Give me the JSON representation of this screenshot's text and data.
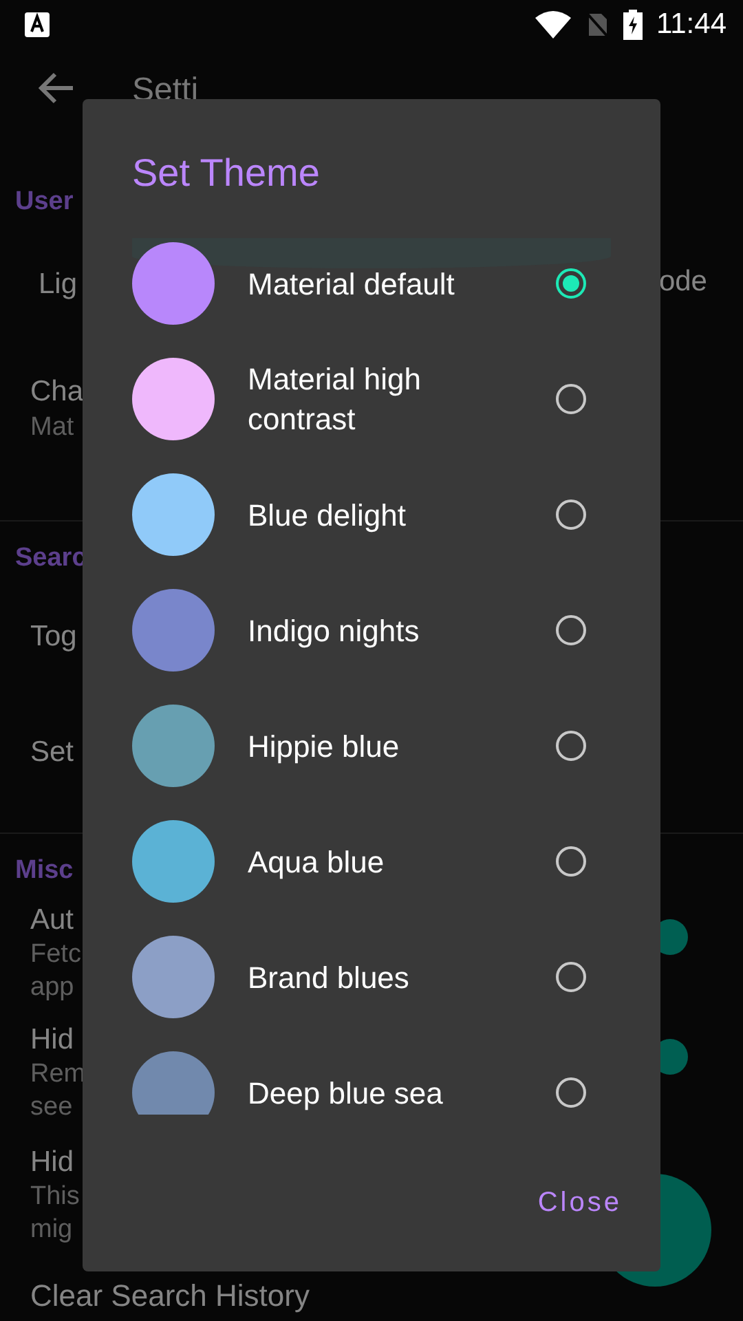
{
  "status_bar": {
    "time": "11:44"
  },
  "app_bar": {
    "title": "Setti"
  },
  "sections": [
    {
      "header": "User",
      "items": [
        {
          "kind": "plain",
          "title": "Lig",
          "trailing": "ode"
        },
        {
          "kind": "plain",
          "title": "Cha",
          "subtitle": [
            "Mat"
          ]
        }
      ]
    },
    {
      "header": "Searc",
      "items": [
        {
          "kind": "plain",
          "title": "Tog"
        },
        {
          "kind": "plain",
          "title": "Set"
        }
      ]
    },
    {
      "header": "Misc",
      "items": [
        {
          "kind": "switch",
          "title": "Aut",
          "subtitle": [
            "Fetc",
            "app"
          ],
          "on": true
        },
        {
          "kind": "switch",
          "title": "Hid",
          "subtitle": [
            "Rem",
            "see"
          ],
          "on": true
        },
        {
          "kind": "plain",
          "title": "Hid",
          "subtitle": [
            "This",
            "mig"
          ]
        },
        {
          "kind": "plain",
          "title": "Clear Search History"
        }
      ]
    }
  ],
  "dialog": {
    "title": "Set Theme",
    "close_button": "Close",
    "options": [
      {
        "label": "Material default",
        "color": "#b887fb",
        "selected": true
      },
      {
        "label": "Material high contrast",
        "color": "#efb8fc",
        "selected": false
      },
      {
        "label": "Blue delight",
        "color": "#90caf9",
        "selected": false
      },
      {
        "label": "Indigo nights",
        "color": "#7986cb",
        "selected": false
      },
      {
        "label": "Hippie blue",
        "color": "#679fb1",
        "selected": false
      },
      {
        "label": "Aqua blue",
        "color": "#5bb2d5",
        "selected": false
      },
      {
        "label": "Brand blues",
        "color": "#8c9fc6",
        "selected": false
      },
      {
        "label": "Deep blue sea",
        "color": "#7189ad",
        "selected": false
      }
    ]
  }
}
